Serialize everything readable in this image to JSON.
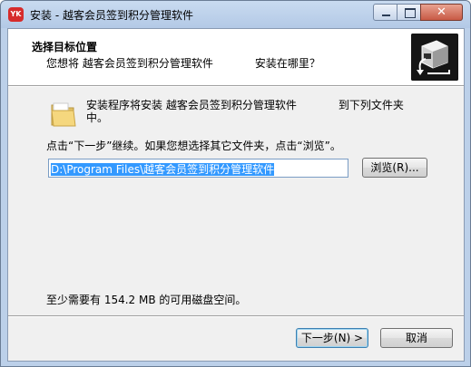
{
  "window": {
    "title": "安装 - 越客会员签到积分管理软件",
    "icon_text": "YK",
    "controls": {
      "minimize": "—",
      "maximize": "□",
      "close": "✕"
    }
  },
  "header": {
    "title": "选择目标位置",
    "subtitle_prefix": "您想将 越客会员签到积分管理软件",
    "subtitle_suffix": "安装在哪里？",
    "image_icon": "computer-install-icon"
  },
  "body": {
    "info_prefix": "安装程序将安装 越客会员签到积分管理软件",
    "info_suffix": "到下列文件夹中。",
    "instruction": "点击“下一步”继续。如果您想选择其它文件夹，点击“浏览”。",
    "path_value": "D:\\Program Files\\越客会员签到积分管理软件",
    "browse_label": "浏览(R)...",
    "space_text": "至少需要有 154.2 MB 的可用磁盘空间。"
  },
  "footer": {
    "next_label": "下一步(N) >",
    "cancel_label": "取消"
  },
  "colors": {
    "selection": "#3399ff",
    "title_bar": "#bcd0e9",
    "close_button": "#c85a45"
  }
}
